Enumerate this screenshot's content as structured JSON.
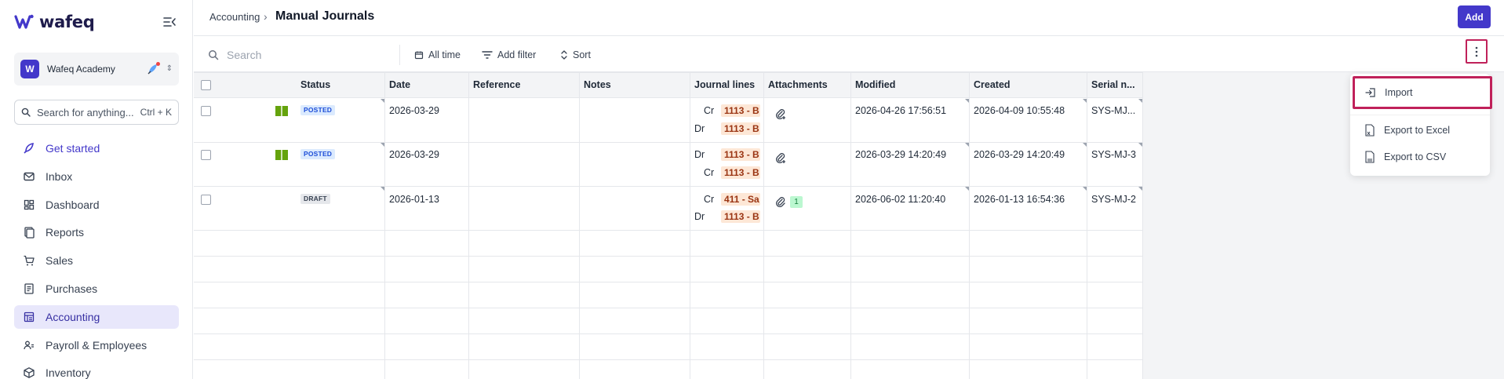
{
  "app": {
    "logo_text": "wafeq"
  },
  "sidebar": {
    "org_name": "Wafeq Academy",
    "org_initial": "W",
    "search_placeholder": "Search for anything...",
    "search_shortcut": "Ctrl + K",
    "items": [
      {
        "label": "Get started",
        "icon": "rocket-icon"
      },
      {
        "label": "Inbox",
        "icon": "inbox-icon"
      },
      {
        "label": "Dashboard",
        "icon": "dashboard-icon"
      },
      {
        "label": "Reports",
        "icon": "reports-icon"
      },
      {
        "label": "Sales",
        "icon": "cart-icon"
      },
      {
        "label": "Purchases",
        "icon": "purchases-icon"
      },
      {
        "label": "Accounting",
        "icon": "ledger-icon",
        "active": true
      },
      {
        "label": "Payroll & Employees",
        "icon": "people-icon"
      },
      {
        "label": "Inventory",
        "icon": "box-icon"
      }
    ]
  },
  "header": {
    "breadcrumb_parent": "Accounting",
    "breadcrumb_separator": "›",
    "title": "Manual Journals",
    "add_label": "Add"
  },
  "toolbar": {
    "search_placeholder": "Search",
    "date_filter": "All time",
    "add_filter": "Add filter",
    "sort": "Sort"
  },
  "table": {
    "columns": [
      "Status",
      "Date",
      "Reference",
      "Notes",
      "Journal lines",
      "Attachments",
      "Modified",
      "Created",
      "Serial n..."
    ],
    "rows": [
      {
        "status": "POSTED",
        "date": "2026-03-29",
        "reference": "",
        "notes": "",
        "lines": [
          {
            "side": "Cr",
            "account": "1113 - B"
          },
          {
            "side": "Dr",
            "account": "1113 - B"
          }
        ],
        "attachments": "",
        "modified": "2026-04-26 17:56:51",
        "created": "2026-04-09 10:55:48",
        "serial": "SYS-MJ..."
      },
      {
        "status": "POSTED",
        "date": "2026-03-29",
        "reference": "",
        "notes": "",
        "lines": [
          {
            "side": "Dr",
            "account": "1113 - B"
          },
          {
            "side": "Cr",
            "account": "1113 - B"
          }
        ],
        "attachments": "",
        "modified": "2026-03-29 14:20:49",
        "created": "2026-03-29 14:20:49",
        "serial": "SYS-MJ-3"
      },
      {
        "status": "DRAFT",
        "date": "2026-01-13",
        "reference": "",
        "notes": "",
        "lines": [
          {
            "side": "Cr",
            "account": "411 - Sa"
          },
          {
            "side": "Dr",
            "account": "1113 - B"
          }
        ],
        "attachments": "1",
        "modified": "2026-06-02 11:20:40",
        "created": "2026-01-13 16:54:36",
        "serial": "SYS-MJ-2"
      }
    ]
  },
  "menu": {
    "items": [
      {
        "label": "Import",
        "icon": "import-icon"
      },
      {
        "label": "Export to Excel",
        "icon": "excel-file-icon"
      },
      {
        "label": "Export to CSV",
        "icon": "csv-file-icon"
      }
    ]
  },
  "colors": {
    "brand": "#4338ca",
    "highlight": "#c0215a",
    "posted_badge": "#dbeafe",
    "account_chip": "#fde7d6",
    "attachment_count": "#bbf7d0"
  }
}
